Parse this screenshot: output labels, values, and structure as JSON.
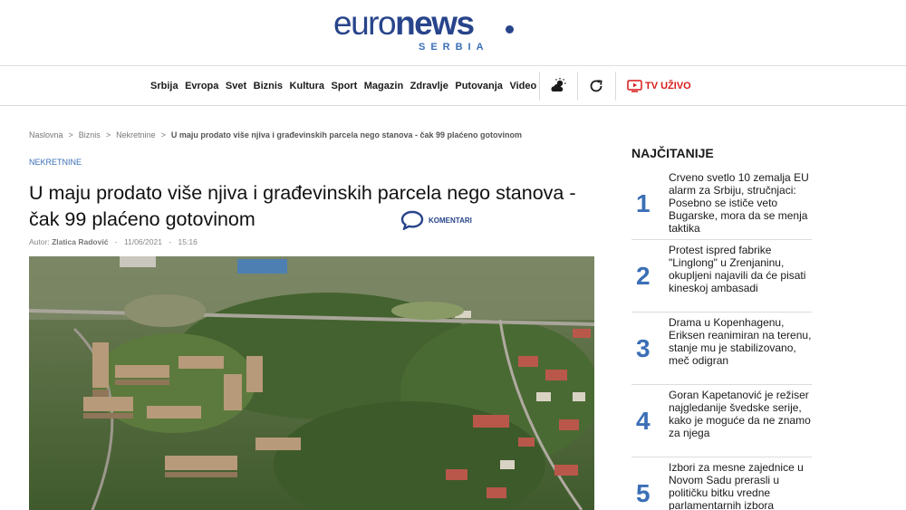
{
  "header": {
    "logo_euro": "euro",
    "logo_news": "news",
    "logo_sub": "SERBIA"
  },
  "nav": {
    "items": [
      "Srbija",
      "Evropa",
      "Svet",
      "Biznis",
      "Kultura",
      "Sport",
      "Magazin",
      "Zdravlje",
      "Putovanja",
      "Video"
    ],
    "weather_icon": "weather-icon",
    "refresh_icon": "refresh-icon",
    "tv_label": "TV UŽIVO",
    "accent_color": "#d7191a"
  },
  "breadcrumb": {
    "items": [
      "Naslovna",
      "Biznis",
      "Nekretnine"
    ],
    "current": "U maju prodato više njiva i građevinskih parcela nego stanova - čak 99 plaćeno gotovinom"
  },
  "article": {
    "category": "NEKRETNINE",
    "title": "U maju prodato više njiva i građevinskih parcela nego stanova - čak 99 plaćeno gotovinom",
    "comments_label": "KOMENTARI",
    "author_prefix": "Autor:",
    "author": "Zlatica Radović",
    "date": "11/06/2021",
    "time": "15:16"
  },
  "sidebar": {
    "title": "NAJČITANIJE",
    "items": [
      {
        "num": "1",
        "text": "Crveno svetlo 10 zemalja EU alarm za Srbiju, stručnjaci: Posebno se ističe veto Bugarske, mora da se menja taktika"
      },
      {
        "num": "2",
        "text": "Protest ispred fabrike \"Linglong\" u Zrenjaninu, okupljeni najavili da će pisati kineskoj ambasadi"
      },
      {
        "num": "3",
        "text": "Drama u Kopenhagenu, Eriksen reanimiran na terenu, stanje mu je stabilizovano, meč odigran"
      },
      {
        "num": "4",
        "text": "Goran Kapetanović je režiser najgledanije švedske serije, kako je moguće da ne znamo za njega"
      },
      {
        "num": "5",
        "text": "Izbori za mesne zajednice u Novom Sadu prerasli u političku bitku vredne parlamentarnih izbora"
      }
    ]
  },
  "colors": {
    "brand": "#28448b",
    "link": "#3b6fb6"
  }
}
